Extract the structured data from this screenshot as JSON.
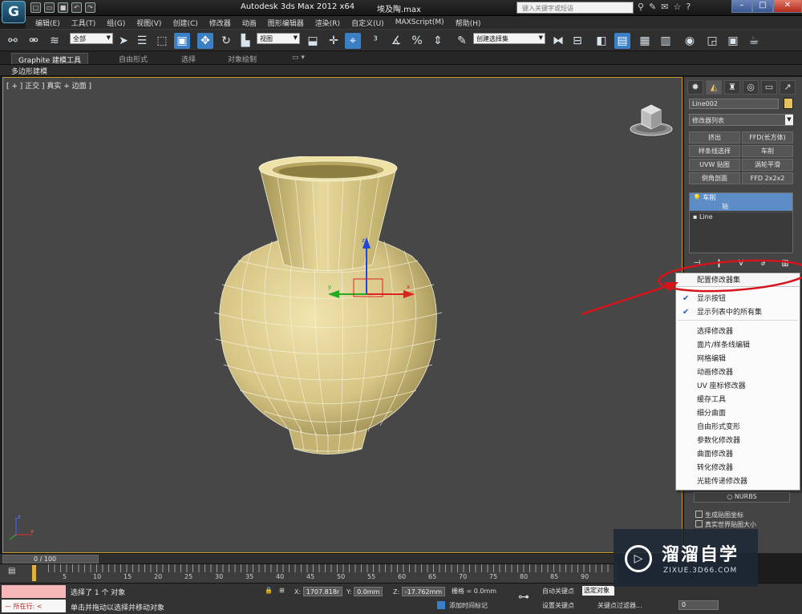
{
  "window": {
    "title": "Autodesk 3ds Max  2012 x64",
    "file": "埃及陶.max",
    "search_placeholder": "键入关键字或短语",
    "logo": "G"
  },
  "menu": [
    "编辑(E)",
    "工具(T)",
    "组(G)",
    "视图(V)",
    "创建(C)",
    "修改器",
    "动画",
    "图形编辑器",
    "渲染(R)",
    "自定义(U)",
    "MAXScript(M)",
    "帮助(H)"
  ],
  "toolbar": {
    "selection_filter": "全部",
    "ref_coord": "视图",
    "named_selection": "创建选择集"
  },
  "ribbon": {
    "tabs": [
      "Graphite 建模工具",
      "自由形式",
      "选择",
      "对象绘制"
    ],
    "active_tab": "Graphite 建模工具",
    "sub_label": "多边形建模"
  },
  "viewport": {
    "label": "[ + ] 正交 ] 真实 + 边面 ]"
  },
  "command_panel": {
    "object_name": "Line002",
    "object_color": "#e8c25d",
    "modifier_list": "修改器列表",
    "modifier_buttons": [
      "挤出",
      "FFD(长方体)",
      "样条线选择",
      "车削",
      "UVW 贴图",
      "涡轮平滑",
      "倒角剖面",
      "FFD 2x2x2"
    ],
    "stack": [
      {
        "label": "车削",
        "selected": true
      },
      {
        "label": "轴",
        "selected": true
      },
      {
        "label": "Line",
        "selected": false
      }
    ],
    "nurbs_label": "NURBS",
    "checkboxes": [
      "生成贴图坐标",
      "真实世界贴图大小"
    ]
  },
  "context_menu": {
    "top_item": "配置修改器集",
    "checked_items": [
      "显示按钮",
      "显示列表中的所有集"
    ],
    "items": [
      "选择修改器",
      "面片/样条线编辑",
      "网格编辑",
      "动画修改器",
      "UV 座标修改器",
      "缓存工具",
      "细分曲面",
      "自由形式变形",
      "参数化修改器",
      "曲面修改器",
      "转化修改器",
      "光能传递修改器"
    ]
  },
  "timeline": {
    "frame_range": "0 / 100",
    "ticks": [
      "5",
      "10",
      "15",
      "20",
      "25",
      "30",
      "35",
      "40",
      "45",
      "50",
      "55",
      "60",
      "65",
      "70",
      "75",
      "80",
      "85",
      "90"
    ]
  },
  "status": {
    "running": "所在行:",
    "selection_msg": "选择了 1 个 对象",
    "prompt_msg": "单击并拖动以选择并移动对象",
    "x_label": "X:",
    "x_value": "1707.818r",
    "y_label": "Y:",
    "y_value": "0.0mm",
    "z_label": "Z:",
    "z_value": "-17.762mm",
    "grid": "栅格 = 0.0mm",
    "add_time_tag": "添加时间标记",
    "auto_key": "自动关键点",
    "set_key": "设置关键点",
    "selected_object": "选定对象",
    "key_filters": "关键点过滤器...",
    "frame_value": "0"
  },
  "watermark": {
    "title": "溜溜自学",
    "url": "ZIXUE.3D66.COM"
  },
  "colors": {
    "accent": "#3b7fc4",
    "viewport_border": "#c79a2a",
    "annotation": "#d6141c",
    "vase": "#d9c98a"
  }
}
